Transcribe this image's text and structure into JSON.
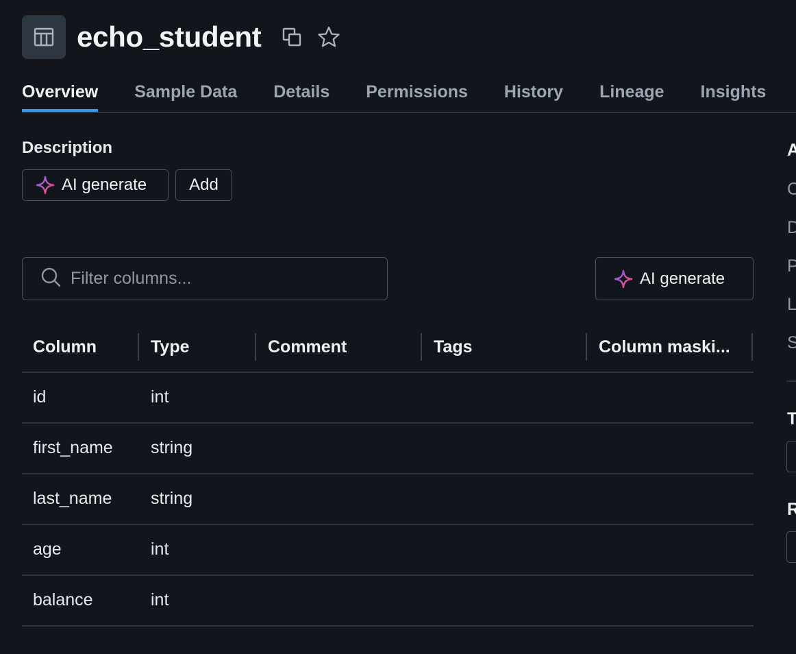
{
  "header": {
    "title": "echo_student",
    "icons": [
      "table-icon",
      "copy-icon",
      "star-icon"
    ]
  },
  "tabs": [
    {
      "label": "Overview",
      "active": true
    },
    {
      "label": "Sample Data",
      "active": false
    },
    {
      "label": "Details",
      "active": false
    },
    {
      "label": "Permissions",
      "active": false
    },
    {
      "label": "History",
      "active": false
    },
    {
      "label": "Lineage",
      "active": false
    },
    {
      "label": "Insights",
      "active": false
    }
  ],
  "description": {
    "label": "Description",
    "ai_generate_label": "AI generate",
    "add_label": "Add"
  },
  "columns_panel": {
    "filter_placeholder": "Filter columns...",
    "ai_generate_label": "AI generate",
    "headers": [
      "Column",
      "Type",
      "Comment",
      "Tags",
      "Column maski..."
    ],
    "rows": [
      {
        "column": "id",
        "type": "int"
      },
      {
        "column": "first_name",
        "type": "string"
      },
      {
        "column": "last_name",
        "type": "string"
      },
      {
        "column": "age",
        "type": "int"
      },
      {
        "column": "balance",
        "type": "int"
      }
    ]
  },
  "side_panel": {
    "heading_clipped": "A",
    "items_clipped": [
      "C",
      "D",
      "P",
      "L",
      "S"
    ],
    "section2_clipped": "T",
    "section3_clipped": "R"
  },
  "colors": {
    "background": "#12161c",
    "accent": "#3b9bea",
    "sparkle_start": "#7b61ff",
    "sparkle_end": "#ff4d6a"
  }
}
